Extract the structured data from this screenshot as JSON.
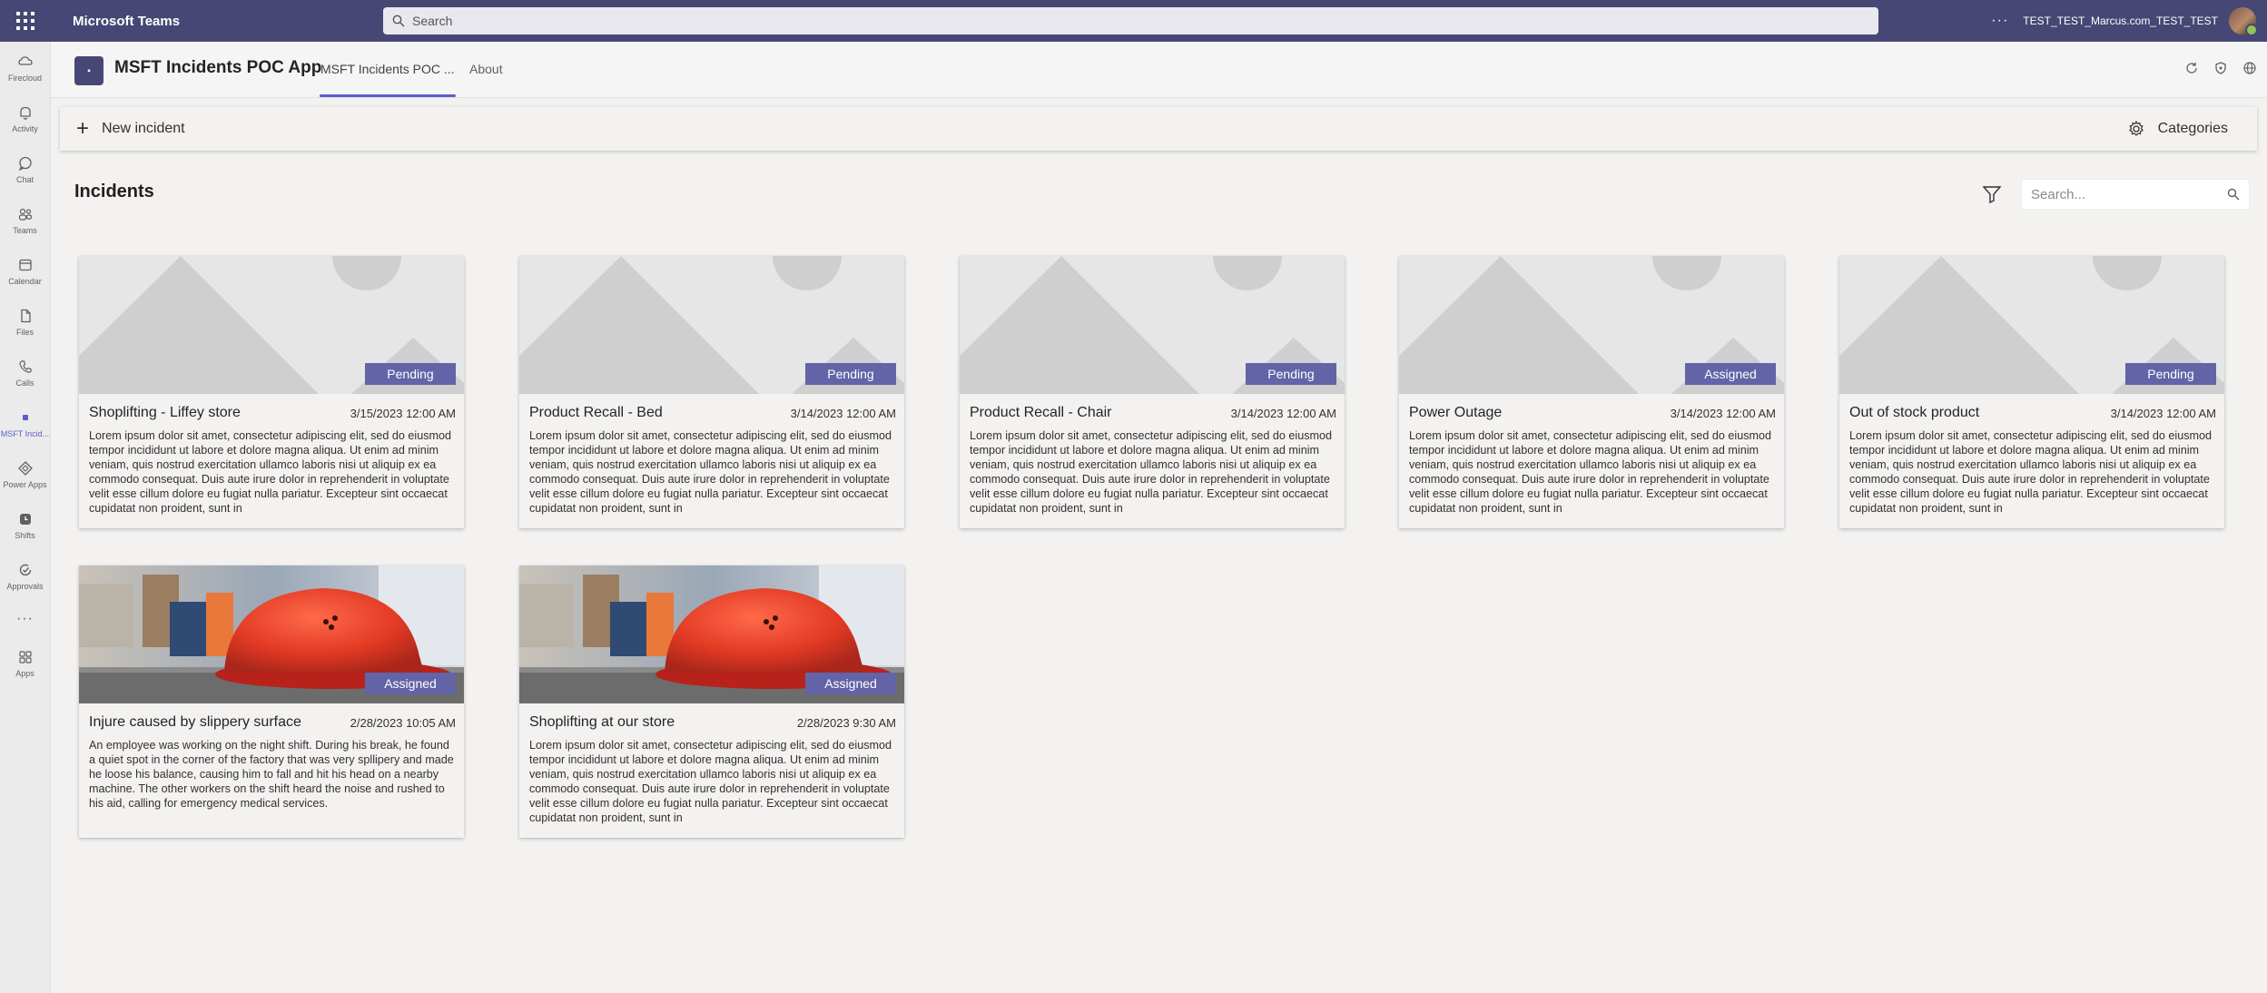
{
  "topbar": {
    "app_title": "Microsoft Teams",
    "search_placeholder": "Search",
    "more_label": "···",
    "user_name": "TEST_TEST_Marcus.com_TEST_TEST"
  },
  "rail": {
    "items": [
      {
        "label": "Firecloud",
        "icon": "firecloud-icon"
      },
      {
        "label": "Activity",
        "icon": "bell-icon"
      },
      {
        "label": "Chat",
        "icon": "chat-icon"
      },
      {
        "label": "Teams",
        "icon": "teams-icon"
      },
      {
        "label": "Calendar",
        "icon": "calendar-icon"
      },
      {
        "label": "Files",
        "icon": "file-icon"
      },
      {
        "label": "Calls",
        "icon": "phone-icon"
      },
      {
        "label": "MSFT Incid...",
        "icon": "app-icon"
      },
      {
        "label": "Power Apps",
        "icon": "power-apps-icon"
      },
      {
        "label": "Shifts",
        "icon": "clock-icon"
      },
      {
        "label": "Approvals",
        "icon": "approvals-icon"
      },
      {
        "label": "Apps",
        "icon": "apps-icon"
      }
    ],
    "more_label": "···"
  },
  "app_header": {
    "app_name": "MSFT Incidents POC App",
    "tabs": [
      {
        "label": "MSFT Incidents POC ...",
        "active": true
      },
      {
        "label": "About",
        "active": false
      }
    ]
  },
  "command_bar": {
    "new_label": "New incident",
    "categories_label": "Categories"
  },
  "list": {
    "title": "Incidents",
    "search_placeholder": "Search..."
  },
  "colors": {
    "brand": "#464775",
    "accent": "#6264a7",
    "background": "#f3f2f1"
  },
  "cards": [
    {
      "title": "Shoplifting - Liffey store",
      "date": "3/15/2023 12:00 AM",
      "status": "Pending",
      "image": "placeholder",
      "desc": "Lorem ipsum dolor sit amet, consectetur adipiscing elit, sed do eiusmod tempor incididunt ut labore et dolore magna aliqua. Ut enim ad minim veniam, quis nostrud exercitation ullamco laboris nisi ut aliquip ex ea commodo consequat. Duis aute irure dolor in reprehenderit in voluptate velit esse cillum dolore eu fugiat nulla pariatur. Excepteur sint occaecat cupidatat non proident, sunt in"
    },
    {
      "title": "Product Recall - Bed",
      "date": "3/14/2023 12:00 AM",
      "status": "Pending",
      "image": "placeholder",
      "desc": "Lorem ipsum dolor sit amet, consectetur adipiscing elit, sed do eiusmod tempor incididunt ut labore et dolore magna aliqua. Ut enim ad minim veniam, quis nostrud exercitation ullamco laboris nisi ut aliquip ex ea commodo consequat. Duis aute irure dolor in reprehenderit in voluptate velit esse cillum dolore eu fugiat nulla pariatur. Excepteur sint occaecat cupidatat non proident, sunt in"
    },
    {
      "title": "Product Recall - Chair",
      "date": "3/14/2023 12:00 AM",
      "status": "Pending",
      "image": "placeholder",
      "desc": "Lorem ipsum dolor sit amet, consectetur adipiscing elit, sed do eiusmod tempor incididunt ut labore et dolore magna aliqua. Ut enim ad minim veniam, quis nostrud exercitation ullamco laboris nisi ut aliquip ex ea commodo consequat. Duis aute irure dolor in reprehenderit in voluptate velit esse cillum dolore eu fugiat nulla pariatur. Excepteur sint occaecat cupidatat non proident, sunt in"
    },
    {
      "title": "Power Outage",
      "date": "3/14/2023 12:00 AM",
      "status": "Assigned",
      "image": "placeholder",
      "desc": "Lorem ipsum dolor sit amet, consectetur adipiscing elit, sed do eiusmod tempor incididunt ut labore et dolore magna aliqua. Ut enim ad minim veniam, quis nostrud exercitation ullamco laboris nisi ut aliquip ex ea commodo consequat. Duis aute irure dolor in reprehenderit in voluptate velit esse cillum dolore eu fugiat nulla pariatur. Excepteur sint occaecat cupidatat non proident, sunt in"
    },
    {
      "title": "Out of stock product",
      "date": "3/14/2023 12:00 AM",
      "status": "Pending",
      "image": "placeholder",
      "desc": "Lorem ipsum dolor sit amet, consectetur adipiscing elit, sed do eiusmod tempor incididunt ut labore et dolore magna aliqua. Ut enim ad minim veniam, quis nostrud exercitation ullamco laboris nisi ut aliquip ex ea commodo consequat. Duis aute irure dolor in reprehenderit in voluptate velit esse cillum dolore eu fugiat nulla pariatur. Excepteur sint occaecat cupidatat non proident, sunt in"
    },
    {
      "title": "Injure caused by slippery surface",
      "date": "2/28/2023 10:05 AM",
      "status": "Assigned",
      "image": "hardhat",
      "desc": "An employee was working on the night shift. During his break, he found a quiet spot in the corner of the factory that was very spllipery and made he loose his balance, causing him to fall and hit his head on a nearby machine. The other workers on the shift heard the noise and rushed to his aid, calling for emergency medical services."
    },
    {
      "title": "Shoplifting at our store",
      "date": "2/28/2023 9:30 AM",
      "status": "Assigned",
      "image": "hardhat",
      "desc": "Lorem ipsum dolor sit amet, consectetur adipiscing elit, sed do eiusmod tempor incididunt ut labore et dolore magna aliqua. Ut enim ad minim veniam, quis nostrud exercitation ullamco laboris nisi ut aliquip ex ea commodo consequat. Duis aute irure dolor in reprehenderit in voluptate velit esse cillum dolore eu fugiat nulla pariatur. Excepteur sint occaecat cupidatat non proident, sunt in"
    }
  ]
}
